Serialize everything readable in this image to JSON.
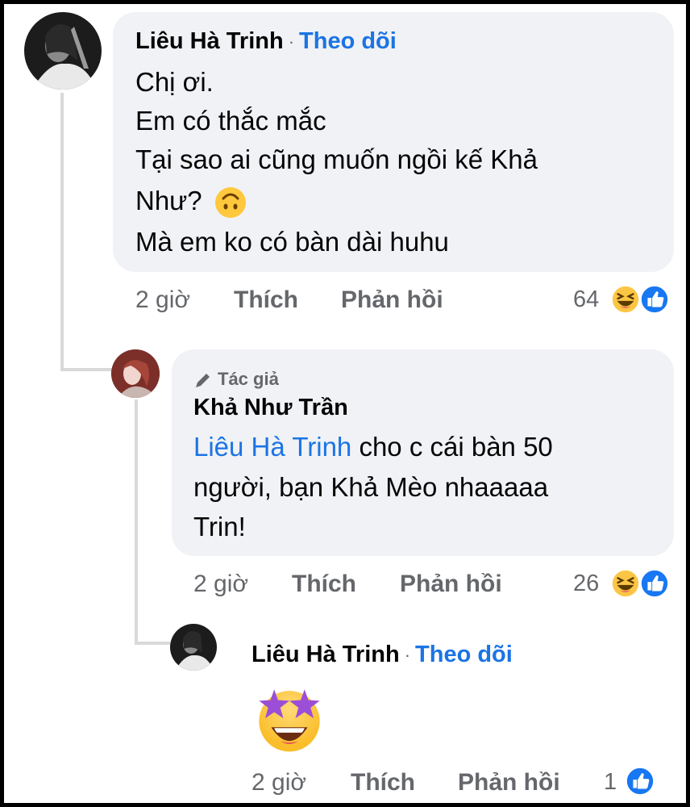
{
  "comments": [
    {
      "name": "Liêu Hà Trinh",
      "follow": "Theo dõi",
      "lines": [
        "Chị ơi.",
        "Em có thắc mắc",
        "Tại sao ai cũng muốn ngồi kế Khả",
        "Như?",
        "Mà em ko có bàn dài huhu"
      ],
      "time": "2 giờ",
      "like": "Thích",
      "reply": "Phản hồi",
      "reaction_count": "64",
      "reaction_icons": [
        "haha-icon",
        "like-icon"
      ]
    },
    {
      "badge": "Tác giả",
      "name": "Khả Như Trần",
      "mention": "Liêu Hà Trinh",
      "lines": [
        " cho c cái bàn 50",
        "người, bạn Khả Mèo nhaaaaa",
        "Trin!"
      ],
      "time": "2 giờ",
      "like": "Thích",
      "reply": "Phản hồi",
      "reaction_count": "26",
      "reaction_icons": [
        "haha-icon",
        "like-icon"
      ]
    },
    {
      "name": "Liêu Hà Trinh",
      "follow": "Theo dõi",
      "sticker": "star-struck-emoji",
      "time": "2 giờ",
      "like": "Thích",
      "reply": "Phản hồi",
      "reaction_count": "1",
      "reaction_icons": [
        "like-icon"
      ]
    }
  ],
  "colors": {
    "link": "#1b74e4",
    "bubble": "#f0f2f5",
    "meta": "#65676b"
  }
}
